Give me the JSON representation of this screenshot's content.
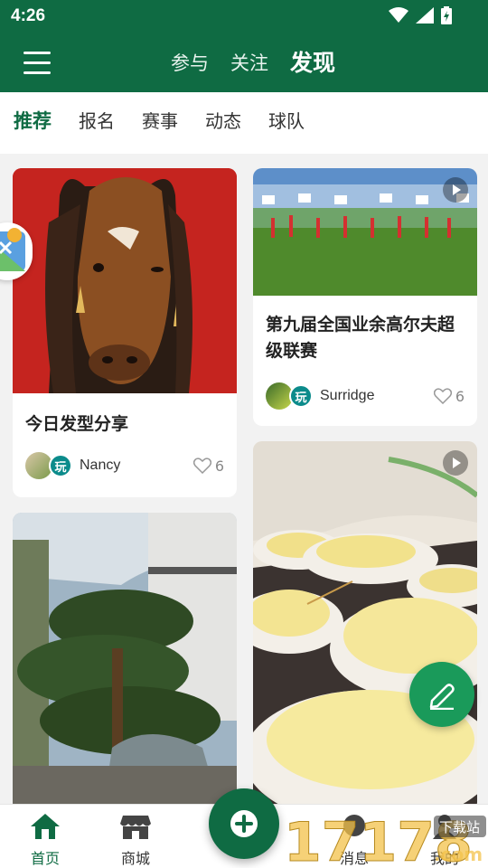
{
  "status_bar": {
    "time": "4:26",
    "icons": [
      "wifi-icon",
      "signal-icon",
      "battery-charging-icon"
    ]
  },
  "app_bar": {
    "menu_icon": "menu-icon",
    "tabs": [
      "参与",
      "关注",
      "发现"
    ],
    "active_tab": "发现"
  },
  "category_tabs": {
    "items": [
      "推荐",
      "报名",
      "赛事",
      "动态",
      "球队"
    ],
    "active": "推荐"
  },
  "feed": [
    {
      "title": "今日发型分享",
      "author": "Nancy",
      "badge": "玩",
      "likes": "6",
      "image": "horse-photo",
      "video": false
    },
    {
      "title": "第九届全国业余高尔夫超级联赛",
      "author": "Surridge",
      "badge": "玩",
      "likes": "6",
      "image": "golf-ceremony-photo",
      "video": true
    },
    {
      "title": "",
      "author": "",
      "badge": "",
      "likes": "",
      "image": "pine-tree-photo",
      "video": false
    },
    {
      "title": "",
      "author": "",
      "badge": "",
      "likes": "",
      "image": "pomelo-plates-photo",
      "video": true
    }
  ],
  "float_buttons": {
    "edit": "pencil-icon",
    "side": "promo-icon"
  },
  "bottom_nav": {
    "items": [
      {
        "label": "首页",
        "icon": "home-icon",
        "active": true
      },
      {
        "label": "商城",
        "icon": "shop-icon",
        "active": false
      },
      {
        "label": "消息",
        "icon": "message-icon",
        "active": false
      },
      {
        "label": "我的",
        "icon": "profile-icon",
        "active": false
      }
    ],
    "center_icon": "add-icon"
  },
  "watermark": {
    "text": "17178",
    "suffix": ".com",
    "tag": "下载站"
  },
  "colors": {
    "primary": "#0f6b43",
    "accent_fab": "#1a9a5a",
    "badge": "#0b8b8b",
    "background": "#f2f2f2"
  }
}
